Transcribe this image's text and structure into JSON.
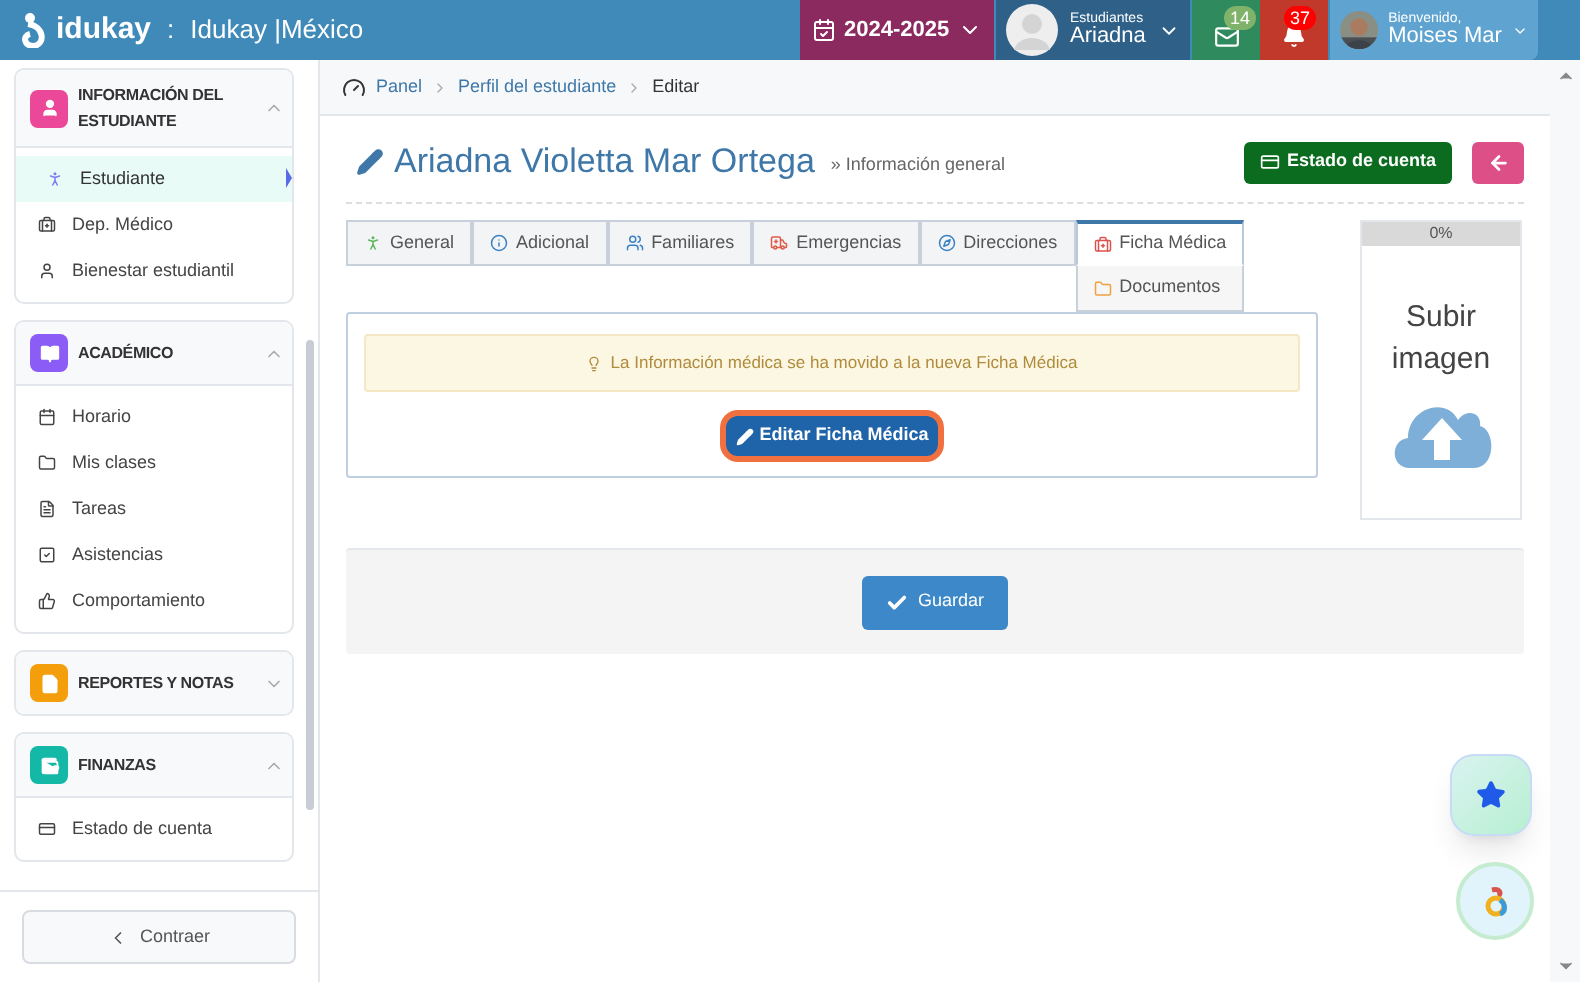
{
  "header": {
    "logo": "idukay",
    "separator": ":",
    "school": "Idukay |México",
    "year": "2024-2025",
    "student_label": "Estudiantes",
    "student_name": "Ariadna",
    "messages_count": "14",
    "notifications_count": "37",
    "welcome": "Bienvenido,",
    "user_name": "Moises Mar"
  },
  "sidebar": {
    "sections": [
      {
        "title": "INFORMACIÓN DEL ESTUDIANTE",
        "color": "#ec4899",
        "expanded": true,
        "items": [
          {
            "label": "Estudiante",
            "selected": true
          },
          {
            "label": "Dep. Médico",
            "selected": false
          },
          {
            "label": "Bienestar estudiantil",
            "selected": false
          }
        ]
      },
      {
        "title": "ACADÉMICO",
        "color": "#8b5cf6",
        "expanded": true,
        "items": [
          {
            "label": "Horario",
            "selected": false
          },
          {
            "label": "Mis clases",
            "selected": false
          },
          {
            "label": "Tareas",
            "selected": false
          },
          {
            "label": "Asistencias",
            "selected": false
          },
          {
            "label": "Comportamiento",
            "selected": false
          }
        ]
      },
      {
        "title": "REPORTES Y NOTAS",
        "color": "#f59e0b",
        "expanded": false
      },
      {
        "title": "FINANZAS",
        "color": "#14b8a6",
        "expanded": true,
        "items": [
          {
            "label": "Estado de cuenta",
            "selected": false
          }
        ]
      }
    ],
    "collapse": "Contraer"
  },
  "breadcrumb": [
    "Panel",
    "Perfil del estudiante",
    "Editar"
  ],
  "page": {
    "title": "Ariadna Violetta Mar Ortega",
    "subtitle": "» Información general",
    "account_button": "Estado de cuenta"
  },
  "tabs": [
    {
      "label": "General",
      "selected": false
    },
    {
      "label": "Adicional",
      "selected": false
    },
    {
      "label": "Familiares",
      "selected": false
    },
    {
      "label": "Emergencias",
      "selected": false
    },
    {
      "label": "Direcciones",
      "selected": false
    },
    {
      "label": "Ficha Médica",
      "selected": true
    }
  ],
  "tab_dropdown": [
    "Documentos"
  ],
  "notice": "La Información médica se ha movido a la nueva Ficha Médica",
  "edit_button": "Editar Ficha Médica",
  "upload": {
    "progress": "0%",
    "level": 0,
    "label": "Subir imagen"
  },
  "save_button": "Guardar"
}
